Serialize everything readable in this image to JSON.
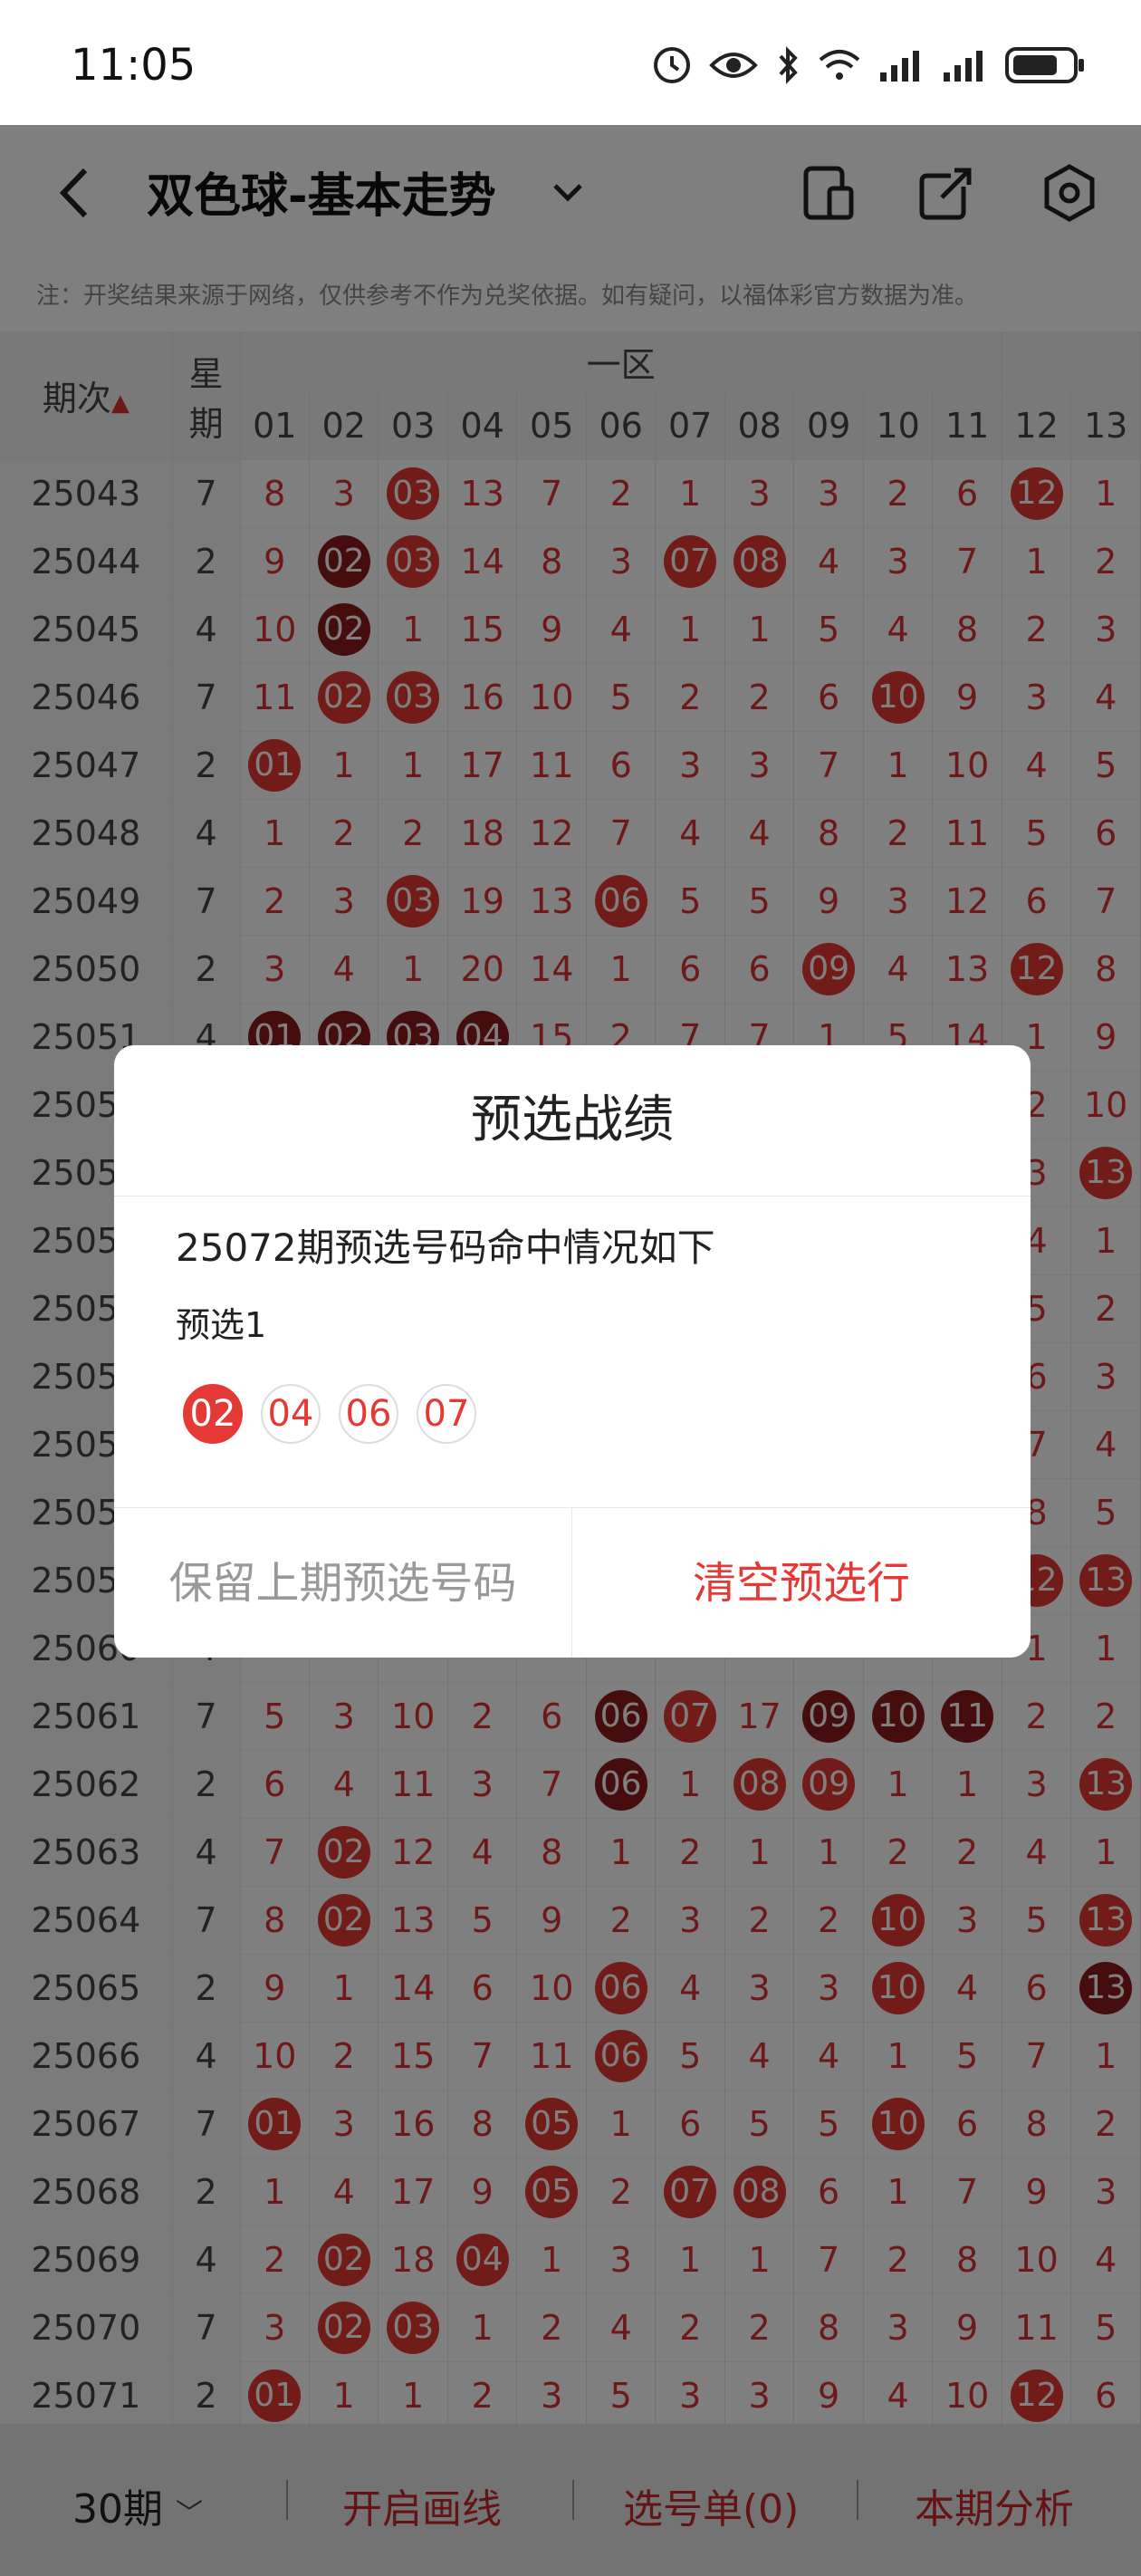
{
  "status": {
    "time": "11:05"
  },
  "appbar": {
    "title": "双色球-基本走势"
  },
  "notice": "注：开奖结果来源于网络，仅供参考不作为兑奖依据。如有疑问，以福体彩官方数据为准。",
  "grid": {
    "header_issue": "期次",
    "header_week": "星期",
    "header_zone": "一区",
    "columns": [
      "01",
      "02",
      "03",
      "04",
      "05",
      "06",
      "07",
      "08",
      "09",
      "10",
      "11",
      "12",
      "13"
    ],
    "rows": [
      {
        "issue": "25043",
        "week": "7",
        "cells": [
          "8",
          "3",
          "03",
          "13",
          "7",
          "2",
          "1",
          "3",
          "3",
          "2",
          "6",
          "12",
          "1"
        ],
        "hits": [
          2,
          11
        ]
      },
      {
        "issue": "25044",
        "week": "2",
        "cells": [
          "9",
          "02",
          "03",
          "14",
          "8",
          "3",
          "07",
          "08",
          "4",
          "3",
          "7",
          "1",
          "2"
        ],
        "hits": [
          1,
          2,
          6,
          7
        ]
      },
      {
        "issue": "25045",
        "week": "4",
        "cells": [
          "10",
          "02",
          "1",
          "15",
          "9",
          "4",
          "1",
          "1",
          "5",
          "4",
          "8",
          "2",
          "3"
        ],
        "hits": [
          1
        ]
      },
      {
        "issue": "25046",
        "week": "7",
        "cells": [
          "11",
          "02",
          "03",
          "16",
          "10",
          "5",
          "2",
          "2",
          "6",
          "10",
          "9",
          "3",
          "4"
        ],
        "hits": [
          1,
          2,
          9
        ]
      },
      {
        "issue": "25047",
        "week": "2",
        "cells": [
          "01",
          "1",
          "1",
          "17",
          "11",
          "6",
          "3",
          "3",
          "7",
          "1",
          "10",
          "4",
          "5"
        ],
        "hits": [
          0
        ]
      },
      {
        "issue": "25048",
        "week": "4",
        "cells": [
          "1",
          "2",
          "2",
          "18",
          "12",
          "7",
          "4",
          "4",
          "8",
          "2",
          "11",
          "5",
          "6"
        ],
        "hits": []
      },
      {
        "issue": "25049",
        "week": "7",
        "cells": [
          "2",
          "3",
          "03",
          "19",
          "13",
          "06",
          "5",
          "5",
          "9",
          "3",
          "12",
          "6",
          "7"
        ],
        "hits": [
          2,
          5
        ]
      },
      {
        "issue": "25050",
        "week": "2",
        "cells": [
          "3",
          "4",
          "1",
          "20",
          "14",
          "1",
          "6",
          "6",
          "09",
          "4",
          "13",
          "12",
          "8"
        ],
        "hits": [
          8,
          11
        ]
      },
      {
        "issue": "25051",
        "week": "4",
        "cells": [
          "01",
          "02",
          "03",
          "04",
          "15",
          "2",
          "7",
          "7",
          "1",
          "5",
          "14",
          "1",
          "9"
        ],
        "hits": [
          0,
          1,
          2,
          3
        ]
      },
      {
        "issue": "25052",
        "week": "7",
        "cells": [
          "",
          "",
          "",
          "",
          "",
          "",
          "",
          "",
          "",
          "",
          "",
          "2",
          "10"
        ],
        "hits": []
      },
      {
        "issue": "25053",
        "week": "2",
        "cells": [
          "",
          "",
          "",
          "",
          "",
          "",
          "",
          "",
          "",
          "",
          "",
          "3",
          "13"
        ],
        "hits": [
          12
        ]
      },
      {
        "issue": "25054",
        "week": "4",
        "cells": [
          "",
          "",
          "",
          "",
          "",
          "",
          "",
          "",
          "",
          "",
          "",
          "4",
          "1"
        ],
        "hits": []
      },
      {
        "issue": "25055",
        "week": "7",
        "cells": [
          "",
          "",
          "",
          "",
          "",
          "",
          "",
          "",
          "",
          "",
          "",
          "5",
          "2"
        ],
        "hits": []
      },
      {
        "issue": "25056",
        "week": "2",
        "cells": [
          "",
          "",
          "",
          "",
          "",
          "",
          "",
          "",
          "",
          "",
          "",
          "6",
          "3"
        ],
        "hits": []
      },
      {
        "issue": "25057",
        "week": "4",
        "cells": [
          "",
          "",
          "",
          "",
          "",
          "",
          "",
          "",
          "",
          "",
          "",
          "7",
          "4"
        ],
        "hits": []
      },
      {
        "issue": "25058",
        "week": "7",
        "cells": [
          "",
          "",
          "",
          "",
          "",
          "",
          "",
          "",
          "",
          "",
          "",
          "8",
          "5"
        ],
        "hits": []
      },
      {
        "issue": "25059",
        "week": "2",
        "cells": [
          "",
          "",
          "",
          "",
          "",
          "",
          "",
          "",
          "",
          "",
          "",
          "12",
          "13"
        ],
        "hits": [
          11,
          12
        ]
      },
      {
        "issue": "25060",
        "week": "4",
        "cells": [
          "",
          "",
          "",
          "",
          "",
          "",
          "",
          "",
          "",
          "",
          "",
          "1",
          "1"
        ],
        "hits": []
      },
      {
        "issue": "25061",
        "week": "7",
        "cells": [
          "5",
          "3",
          "10",
          "2",
          "6",
          "06",
          "07",
          "17",
          "09",
          "10",
          "11",
          "2",
          "2"
        ],
        "hits": [
          5,
          6,
          8,
          9,
          10
        ]
      },
      {
        "issue": "25062",
        "week": "2",
        "cells": [
          "6",
          "4",
          "11",
          "3",
          "7",
          "06",
          "1",
          "08",
          "09",
          "1",
          "1",
          "3",
          "13"
        ],
        "hits": [
          5,
          7,
          8,
          12
        ]
      },
      {
        "issue": "25063",
        "week": "4",
        "cells": [
          "7",
          "02",
          "12",
          "4",
          "8",
          "1",
          "2",
          "1",
          "1",
          "2",
          "2",
          "4",
          "1"
        ],
        "hits": [
          1
        ]
      },
      {
        "issue": "25064",
        "week": "7",
        "cells": [
          "8",
          "02",
          "13",
          "5",
          "9",
          "2",
          "3",
          "2",
          "2",
          "10",
          "3",
          "5",
          "13"
        ],
        "hits": [
          1,
          9,
          12
        ]
      },
      {
        "issue": "25065",
        "week": "2",
        "cells": [
          "9",
          "1",
          "14",
          "6",
          "10",
          "06",
          "4",
          "3",
          "3",
          "10",
          "4",
          "6",
          "13"
        ],
        "hits": [
          5,
          9,
          12
        ]
      },
      {
        "issue": "25066",
        "week": "4",
        "cells": [
          "10",
          "2",
          "15",
          "7",
          "11",
          "06",
          "5",
          "4",
          "4",
          "1",
          "5",
          "7",
          "1"
        ],
        "hits": [
          5
        ]
      },
      {
        "issue": "25067",
        "week": "7",
        "cells": [
          "01",
          "3",
          "16",
          "8",
          "05",
          "1",
          "6",
          "5",
          "5",
          "10",
          "6",
          "8",
          "2"
        ],
        "hits": [
          0,
          4,
          9
        ]
      },
      {
        "issue": "25068",
        "week": "2",
        "cells": [
          "1",
          "4",
          "17",
          "9",
          "05",
          "2",
          "07",
          "08",
          "6",
          "1",
          "7",
          "9",
          "3"
        ],
        "hits": [
          4,
          6,
          7
        ]
      },
      {
        "issue": "25069",
        "week": "4",
        "cells": [
          "2",
          "02",
          "18",
          "04",
          "1",
          "3",
          "1",
          "1",
          "7",
          "2",
          "8",
          "10",
          "4"
        ],
        "hits": [
          1,
          3
        ]
      },
      {
        "issue": "25070",
        "week": "7",
        "cells": [
          "3",
          "02",
          "03",
          "1",
          "2",
          "4",
          "2",
          "2",
          "8",
          "3",
          "9",
          "11",
          "5"
        ],
        "hits": [
          1,
          2
        ]
      },
      {
        "issue": "25071",
        "week": "2",
        "cells": [
          "01",
          "1",
          "1",
          "2",
          "3",
          "5",
          "3",
          "3",
          "9",
          "4",
          "10",
          "12",
          "6"
        ],
        "hits": [
          0,
          11
        ]
      }
    ]
  },
  "dialog": {
    "title": "预选战绩",
    "subtitle": "25072期预选号码命中情况如下",
    "pick_label": "预选1",
    "balls": [
      {
        "num": "02",
        "hit": true
      },
      {
        "num": "04",
        "hit": false
      },
      {
        "num": "06",
        "hit": false
      },
      {
        "num": "07",
        "hit": false
      }
    ],
    "btn_keep": "保留上期预选号码",
    "btn_clear": "清空预选行"
  },
  "bottombar": {
    "periods": "30期",
    "draw_line": "开启画线",
    "picklist": "选号单(0)",
    "analysis": "本期分析"
  }
}
